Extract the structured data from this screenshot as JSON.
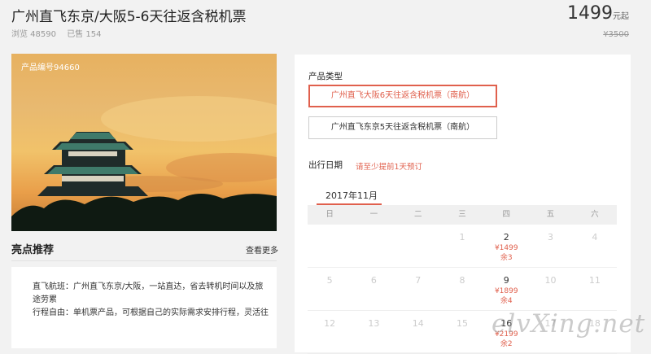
{
  "product": {
    "title": "广州直飞东京/大阪5-6天往返含税机票",
    "views": "浏览 48590",
    "sold": "已售 154",
    "price": "1499",
    "price_unit": "元起",
    "original_price": "¥3500",
    "product_code": "产品编号94660"
  },
  "highlights": {
    "title": "亮点推荐",
    "more_link": "查看更多",
    "lines": [
      "直飞航班：广州直飞东京/大阪，一站直达，省去转机时间以及旅",
      "途劳累",
      "行程自由：单机票产品，可根据自己的实际需求安排行程，灵活往"
    ]
  },
  "booking": {
    "type_label": "产品类型",
    "options": [
      {
        "label": "广州直飞大阪6天往返含税机票（南航）",
        "selected": true
      },
      {
        "label": "广州直飞东京5天往返含税机票（南航）",
        "selected": false
      }
    ],
    "date_label": "出行日期",
    "date_note": "请至少提前1天预订",
    "month": "2017年11月",
    "weekdays": [
      "日",
      "一",
      "二",
      "三",
      "四",
      "五",
      "六"
    ],
    "weeks": [
      [
        {
          "d": ""
        },
        {
          "d": ""
        },
        {
          "d": ""
        },
        {
          "d": "1"
        },
        {
          "d": "2",
          "p": "¥1499",
          "s": "余3"
        },
        {
          "d": "3"
        },
        {
          "d": "4"
        }
      ],
      [
        {
          "d": "5"
        },
        {
          "d": "6"
        },
        {
          "d": "7"
        },
        {
          "d": "8"
        },
        {
          "d": "9",
          "p": "¥1899",
          "s": "余4"
        },
        {
          "d": "10"
        },
        {
          "d": "11"
        }
      ],
      [
        {
          "d": "12"
        },
        {
          "d": "13"
        },
        {
          "d": "14"
        },
        {
          "d": "15"
        },
        {
          "d": "16",
          "p": "¥2199",
          "s": "余2"
        },
        {
          "d": "17"
        },
        {
          "d": "18"
        }
      ]
    ]
  },
  "watermark": "elvXing.net"
}
